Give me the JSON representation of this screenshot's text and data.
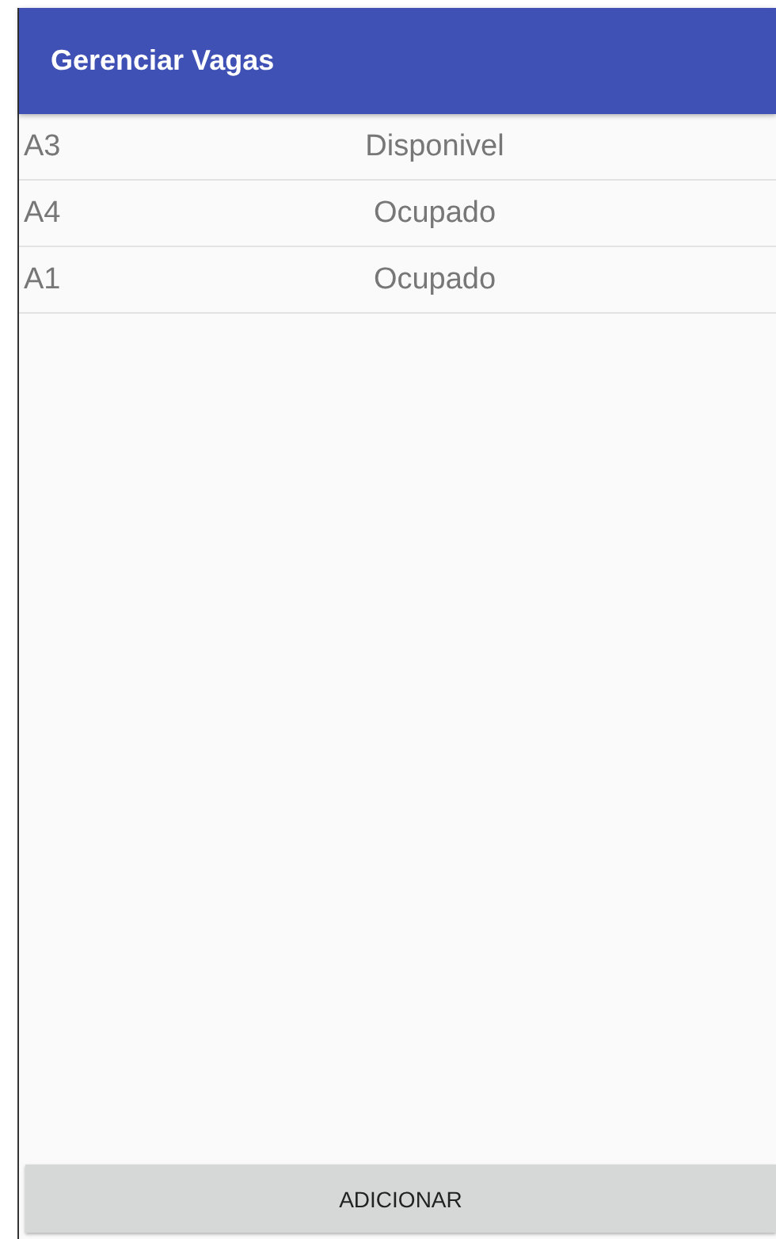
{
  "app_bar": {
    "title": "Gerenciar Vagas"
  },
  "rows": [
    {
      "name": "A3",
      "status": "Disponivel"
    },
    {
      "name": "A4",
      "status": "Ocupado"
    },
    {
      "name": "A1",
      "status": "Ocupado"
    }
  ],
  "button": {
    "label": "ADICIONAR"
  }
}
